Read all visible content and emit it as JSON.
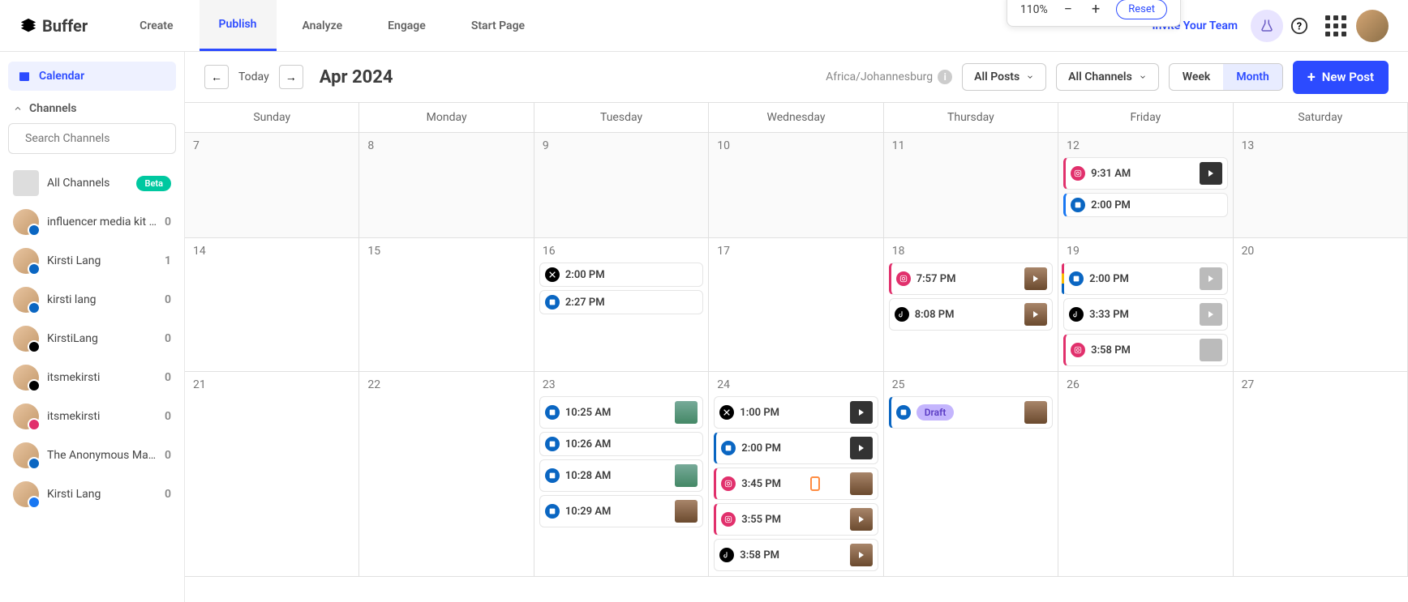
{
  "brand": "Buffer",
  "nav": {
    "create": "Create",
    "publish": "Publish",
    "analyze": "Analyze",
    "engage": "Engage",
    "startpage": "Start Page"
  },
  "invite": "Invite Your Team",
  "zoom": {
    "pct": "110%",
    "reset": "Reset"
  },
  "sidebar": {
    "calendar": "Calendar",
    "channels_label": "Channels",
    "search_placeholder": "Search Channels",
    "all_channels": "All Channels",
    "beta": "Beta",
    "items": [
      {
        "name": "influencer media kit te...",
        "count": "0",
        "badge": "li"
      },
      {
        "name": "Kirsti Lang",
        "count": "1",
        "badge": "li"
      },
      {
        "name": "kirsti lang",
        "count": "0",
        "badge": "li"
      },
      {
        "name": "KirstiLang",
        "count": "0",
        "badge": "x"
      },
      {
        "name": "itsmekirsti",
        "count": "0",
        "badge": "tk"
      },
      {
        "name": "itsmekirsti",
        "count": "0",
        "badge": "ig"
      },
      {
        "name": "The Anonymous Marke...",
        "count": "0",
        "badge": "li"
      },
      {
        "name": "Kirsti Lang",
        "count": "0",
        "badge": "fb"
      }
    ]
  },
  "toolbar": {
    "today": "Today",
    "month_label": "Apr 2024",
    "timezone": "Africa/Johannesburg",
    "all_posts": "All Posts",
    "all_channels": "All Channels",
    "week": "Week",
    "month": "Month",
    "new_post": "New Post"
  },
  "days": [
    "Sunday",
    "Monday",
    "Tuesday",
    "Wednesday",
    "Thursday",
    "Friday",
    "Saturday"
  ],
  "weeks": [
    {
      "nums": [
        "7",
        "8",
        "9",
        "10",
        "11",
        "12",
        "13"
      ],
      "cur": false,
      "cells": [
        [],
        [],
        [],
        [],
        [],
        [
          {
            "net": "ig",
            "time": "9:31 AM",
            "thumb": "dk",
            "play": true,
            "bar": "ig"
          },
          {
            "net": "li",
            "time": "2:00 PM",
            "bar": "fb"
          }
        ],
        []
      ]
    },
    {
      "nums": [
        "14",
        "15",
        "16",
        "17",
        "18",
        "19",
        "20"
      ],
      "cur": true,
      "cells": [
        [],
        [],
        [
          {
            "net": "x",
            "time": "2:00 PM"
          },
          {
            "net": "li",
            "time": "2:27 PM"
          }
        ],
        [],
        [
          {
            "net": "ig",
            "time": "7:57 PM",
            "thumb": "brn",
            "play": true,
            "bar": "ig"
          },
          {
            "net": "tk",
            "time": "8:08 PM",
            "thumb": "brn",
            "play": true
          }
        ],
        [
          {
            "net": "li",
            "time": "2:00 PM",
            "thumb": "gry",
            "play": true,
            "bar": "multi"
          },
          {
            "net": "tk",
            "time": "3:33 PM",
            "thumb": "gry",
            "play": true
          },
          {
            "net": "ig",
            "time": "3:58 PM",
            "thumb": "gry",
            "bar": "ig"
          }
        ],
        []
      ]
    },
    {
      "nums": [
        "21",
        "22",
        "23",
        "24",
        "25",
        "26",
        "27"
      ],
      "cur": true,
      "cells": [
        [],
        [],
        [
          {
            "net": "li",
            "time": "10:25 AM",
            "thumb": "grn"
          },
          {
            "net": "li",
            "time": "10:26 AM"
          },
          {
            "net": "li",
            "time": "10:28 AM",
            "thumb": "grn"
          },
          {
            "net": "li",
            "time": "10:29 AM",
            "thumb": "brn"
          }
        ],
        [
          {
            "net": "x",
            "time": "1:00 PM",
            "thumb": "dk",
            "play": true
          },
          {
            "net": "li",
            "time": "2:00 PM",
            "thumb": "dk",
            "play": true,
            "bar": "li"
          },
          {
            "net": "ig",
            "time": "3:45 PM",
            "mobile": true,
            "thumb": "brn",
            "bar": "ig"
          },
          {
            "net": "ig",
            "time": "3:55 PM",
            "thumb": "brn",
            "play": true,
            "bar": "ig"
          },
          {
            "net": "tk",
            "time": "3:58 PM",
            "thumb": "brn",
            "play": true
          }
        ],
        [
          {
            "net": "li",
            "draft": "Draft",
            "thumb": "brn",
            "bar": "li"
          }
        ],
        [],
        []
      ]
    }
  ]
}
